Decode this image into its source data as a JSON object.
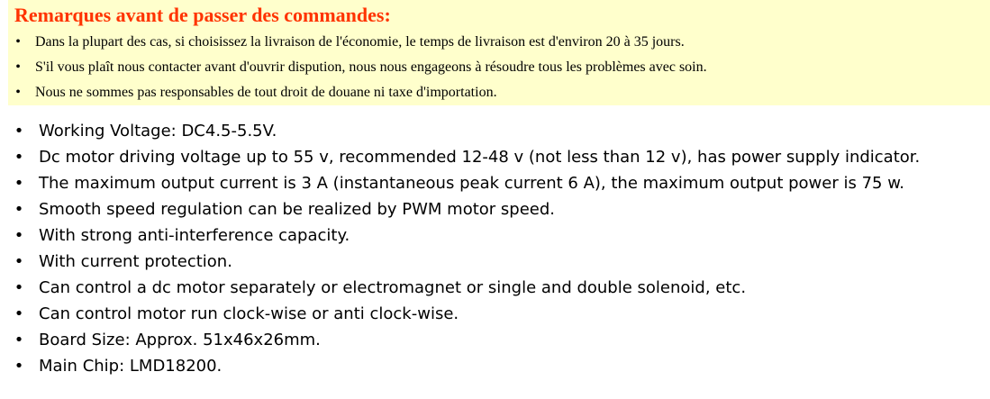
{
  "notice": {
    "title": "Remarques avant de passer des commandes:",
    "bullet": "•",
    "items": [
      "Dans la plupart des cas, si choisissez la livraison de l'économie, le temps de livraison est d'environ 20 à 35 jours.",
      "S'il vous plaît nous contacter avant d'ouvrir dispution, nous nous engageons à résoudre tous les problèmes avec soin.",
      "Nous ne sommes pas responsables de tout droit de douane ni taxe d'importation."
    ],
    "background_color": "#ffffcc",
    "title_color": "#ff3300"
  },
  "features": {
    "bullet": "•",
    "items": [
      "Working Voltage: DC4.5-5.5V.",
      "Dc motor driving voltage up to 55 v, recommended 12-48 v (not less than 12 v), has power supply indicator.",
      "The maximum output current is 3 A (instantaneous peak current 6 A), the maximum output power is 75 w.",
      "Smooth speed regulation can be realized by PWM motor speed.",
      "With strong anti-interference capacity.",
      "With current protection.",
      "Can control a dc motor separately or electromagnet or single and double solenoid, etc.",
      "Can control motor run clock-wise or anti clock-wise.",
      "Board Size: Approx. 51x46x26mm.",
      "Main Chip: LMD18200."
    ]
  }
}
